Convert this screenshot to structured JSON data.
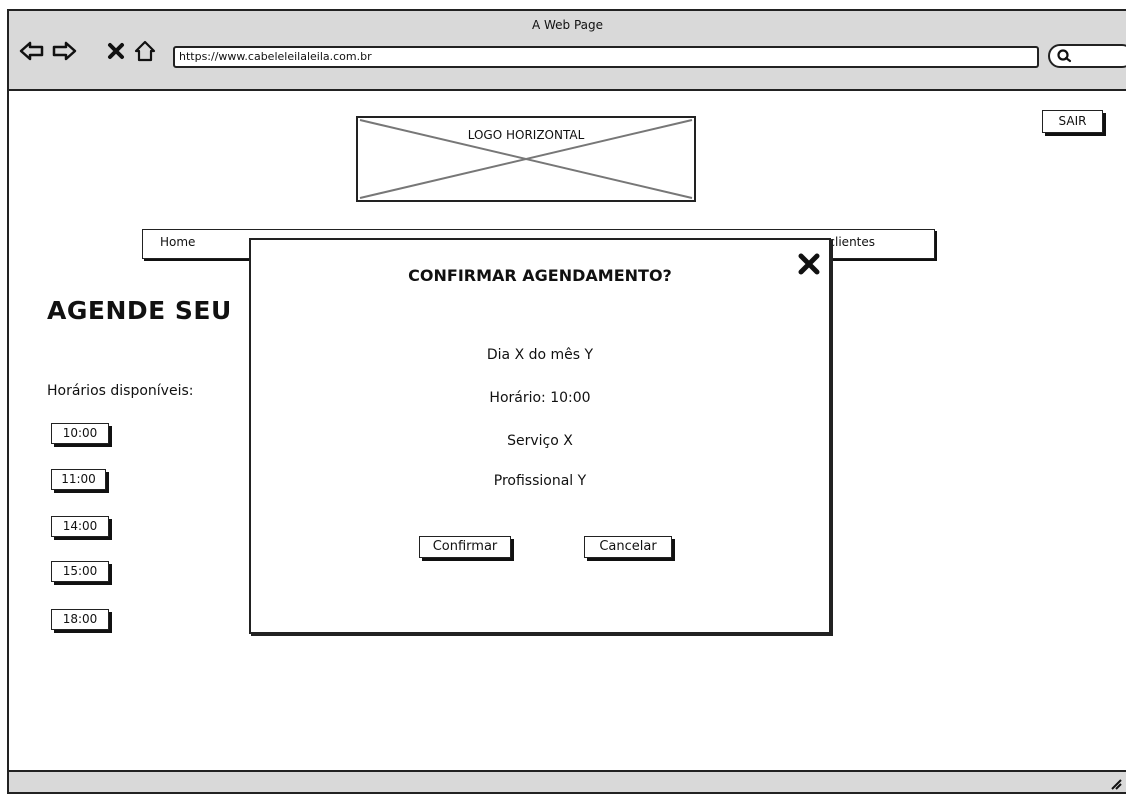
{
  "window": {
    "title": "A Web Page"
  },
  "address_bar": {
    "url": "https://www.cabeleleilaleila.com.br"
  },
  "toolbar_icons": [
    "back-icon",
    "forward-icon",
    "stop-icon",
    "home-icon",
    "search-icon"
  ],
  "header": {
    "logout_label": "SAIR",
    "logo_label": "LOGO HORIZONTAL"
  },
  "nav": {
    "items": [
      "Home",
      "as clientes"
    ]
  },
  "main": {
    "heading": "AGENDE SEU",
    "available_label": "Horários disponíveis:",
    "time_slots": [
      "10:00",
      "11:00",
      "14:00",
      "15:00",
      "18:00"
    ]
  },
  "modal": {
    "title": "CONFIRMAR AGENDAMENTO?",
    "day": "Dia X do mês Y",
    "time": "Horário: 10:00",
    "service": "Serviço X",
    "professional": "Profissional Y",
    "confirm_label": "Confirmar",
    "cancel_label": "Cancelar"
  }
}
